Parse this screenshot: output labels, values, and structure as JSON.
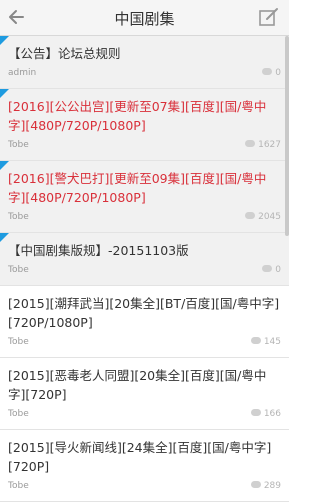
{
  "header": {
    "title": "中国剧集"
  },
  "threads": [
    {
      "title": "【公告】论坛总规则",
      "author": "admin",
      "replies": "0",
      "sticky": true,
      "red": false
    },
    {
      "title": "[2016][公公出宫][更新至07集][百度][国/粤中字][480P/720P/1080P]",
      "author": "Tobe",
      "replies": "1627",
      "sticky": true,
      "red": true
    },
    {
      "title": "[2016][警犬巴打][更新至09集][百度][国/粤中字][480P/720P/1080P]",
      "author": "Tobe",
      "replies": "2045",
      "sticky": true,
      "red": true
    },
    {
      "title": "【中国剧集版规】-20151103版",
      "author": "Tobe",
      "replies": "0",
      "sticky": true,
      "red": false
    },
    {
      "title": "[2015][潮拜武当][20集全][BT/百度][国/粤中字][720P/1080P]",
      "author": "Tobe",
      "replies": "145",
      "sticky": false,
      "red": false
    },
    {
      "title": "[2015][恶毒老人同盟][20集全][百度][国/粤中字][720P]",
      "author": "Tobe",
      "replies": "166",
      "sticky": false,
      "red": false
    },
    {
      "title": "[2015][导火新闻线][24集全][百度][国/粤中字][720P]",
      "author": "Tobe",
      "replies": "289",
      "sticky": false,
      "red": false
    }
  ],
  "colors": {
    "red_title": "#d9303a",
    "flag": "#1e9be0"
  }
}
